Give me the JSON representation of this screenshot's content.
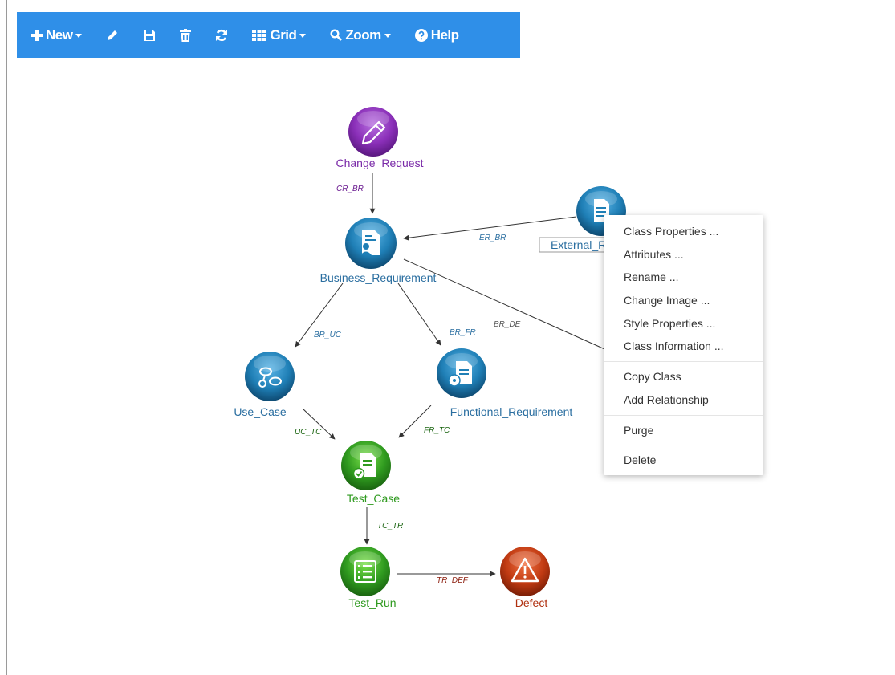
{
  "toolbar": {
    "new_label": "New",
    "grid_label": "Grid",
    "zoom_label": "Zoom",
    "help_label": "Help",
    "color": "#2f8fe8"
  },
  "nodes": {
    "change_request": {
      "label": "Change_Request",
      "color": "#8a2fb8",
      "icon": "pencil-icon"
    },
    "business_requirement": {
      "label": "Business_Requirement",
      "color": "#2a6ea0",
      "icon": "document-person-icon"
    },
    "external_requirement": {
      "label": "External_R",
      "color": "#2a6ea0",
      "icon": "document-icon"
    },
    "use_case": {
      "label": "Use_Case",
      "color": "#2a6ea0",
      "icon": "use-case-icon"
    },
    "functional_requirement": {
      "label": "Functional_Requirement",
      "color": "#2a6ea0",
      "icon": "document-disc-icon"
    },
    "test_case": {
      "label": "Test_Case",
      "color": "#2f9a1f",
      "icon": "document-check-icon"
    },
    "test_run": {
      "label": "Test_Run",
      "color": "#2f9a1f",
      "icon": "checklist-icon"
    },
    "defect": {
      "label": "Defect",
      "color": "#b03010",
      "icon": "warning-icon"
    }
  },
  "edges": {
    "cr_br": "CR_BR",
    "er_br": "ER_BR",
    "br_uc": "BR_UC",
    "br_fr": "BR_FR",
    "br_de": "BR_DE",
    "uc_tc": "UC_TC",
    "fr_tc": "FR_TC",
    "tc_tr": "TC_TR",
    "tr_def": "TR_DEF"
  },
  "context_menu": {
    "class_properties": "Class Properties ...",
    "attributes": "Attributes ...",
    "rename": "Rename ...",
    "change_image": "Change Image ...",
    "style_properties": "Style Properties ...",
    "class_information": "Class Information ...",
    "copy_class": "Copy Class",
    "add_relationship": "Add Relationship",
    "purge": "Purge",
    "delete": "Delete"
  }
}
